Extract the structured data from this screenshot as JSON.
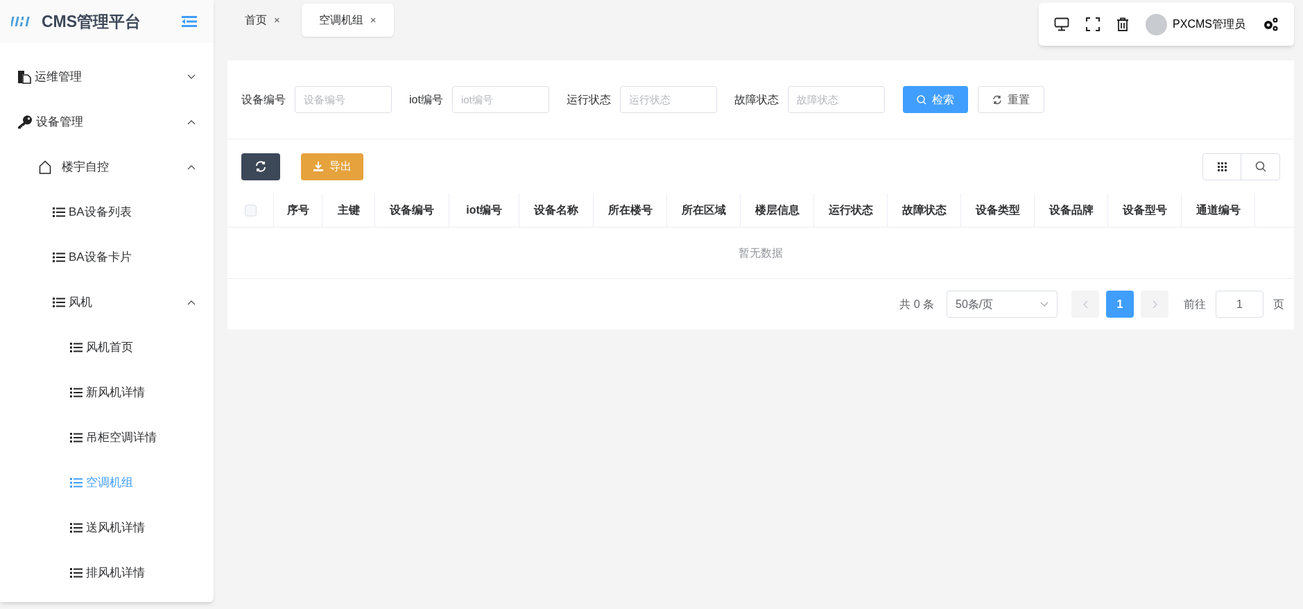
{
  "app": {
    "title": "CMS管理平台"
  },
  "sidebar": {
    "items": [
      {
        "label": "运维管理",
        "expanded": false,
        "selected": false
      },
      {
        "label": "设备管理",
        "expanded": true,
        "selected": false,
        "children": [
          {
            "label": "楼宇自控",
            "expanded": true,
            "selected": false,
            "children": [
              {
                "label": "BA设备列表",
                "selected": false
              },
              {
                "label": "BA设备卡片",
                "selected": false
              },
              {
                "label": "风机",
                "expanded": true,
                "selected": false,
                "children": [
                  {
                    "label": "风机首页",
                    "selected": false
                  },
                  {
                    "label": "新风机详情",
                    "selected": false
                  },
                  {
                    "label": "吊柜空调详情",
                    "selected": false
                  },
                  {
                    "label": "空调机组",
                    "selected": true
                  },
                  {
                    "label": "送风机详情",
                    "selected": false
                  },
                  {
                    "label": "排风机详情",
                    "selected": false
                  }
                ]
              }
            ]
          }
        ]
      }
    ]
  },
  "tabs": [
    {
      "label": "首页",
      "close": "×",
      "selected": false
    },
    {
      "label": "空调机组",
      "close": "×",
      "selected": true
    }
  ],
  "header": {
    "user": "PXCMS管理员"
  },
  "filters": [
    {
      "label": "设备编号",
      "placeholder": "设备编号"
    },
    {
      "label": "iot编号",
      "placeholder": "iot编号"
    },
    {
      "label": "运行状态",
      "placeholder": "运行状态"
    },
    {
      "label": "故障状态",
      "placeholder": "故障状态"
    }
  ],
  "search_button": "检索",
  "reset_button": "重置",
  "export_button": "导出",
  "table": {
    "columns": [
      "序号",
      "主键",
      "设备编号",
      "iot编号",
      "设备名称",
      "所在楼号",
      "所在区域",
      "楼层信息",
      "运行状态",
      "故障状态",
      "设备类型",
      "设备品牌",
      "设备型号",
      "通道编号"
    ],
    "empty_text": "暂无数据",
    "select_all_checked": false
  },
  "pagination": {
    "total": "共 0 条",
    "page_size": "50条/页",
    "pages": [
      {
        "label": "1",
        "selected": true
      }
    ],
    "goto_label": "前往",
    "goto_value": "1",
    "goto_suffix": "页"
  }
}
